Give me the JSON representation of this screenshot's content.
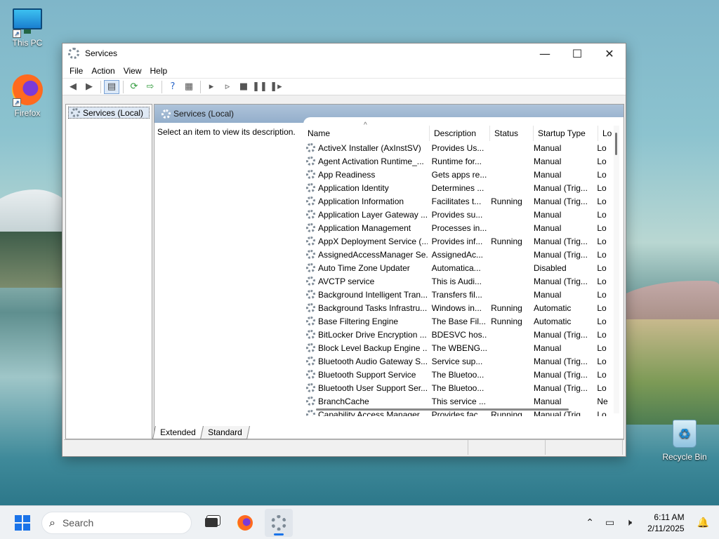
{
  "desktop": {
    "icons": [
      {
        "label": "This PC"
      },
      {
        "label": "Firefox"
      },
      {
        "label": "Recycle Bin"
      }
    ]
  },
  "window": {
    "title": "Services",
    "controls": {
      "minimize": "—",
      "maximize": "☐",
      "close": "✕"
    },
    "menu": [
      "File",
      "Action",
      "View",
      "Help"
    ],
    "tree": {
      "root_label": "Services (Local)"
    },
    "content_header": "Services (Local)",
    "description_prompt": "Select an item to view its description.",
    "columns": {
      "name": "Name",
      "description": "Description",
      "status": "Status",
      "startup": "Startup Type",
      "logon": "Lo"
    },
    "rows": [
      {
        "name": "ActiveX Installer (AxInstSV)",
        "desc": "Provides Us...",
        "status": "",
        "startup": "Manual",
        "logon": "Lo"
      },
      {
        "name": "Agent Activation Runtime_...",
        "desc": "Runtime for...",
        "status": "",
        "startup": "Manual",
        "logon": "Lo"
      },
      {
        "name": "App Readiness",
        "desc": "Gets apps re...",
        "status": "",
        "startup": "Manual",
        "logon": "Lo"
      },
      {
        "name": "Application Identity",
        "desc": "Determines ...",
        "status": "",
        "startup": "Manual (Trig...",
        "logon": "Lo"
      },
      {
        "name": "Application Information",
        "desc": "Facilitates t...",
        "status": "Running",
        "startup": "Manual (Trig...",
        "logon": "Lo"
      },
      {
        "name": "Application Layer Gateway ...",
        "desc": "Provides su...",
        "status": "",
        "startup": "Manual",
        "logon": "Lo"
      },
      {
        "name": "Application Management",
        "desc": "Processes in...",
        "status": "",
        "startup": "Manual",
        "logon": "Lo"
      },
      {
        "name": "AppX Deployment Service (...",
        "desc": "Provides inf...",
        "status": "Running",
        "startup": "Manual (Trig...",
        "logon": "Lo"
      },
      {
        "name": "AssignedAccessManager Se...",
        "desc": "AssignedAc...",
        "status": "",
        "startup": "Manual (Trig...",
        "logon": "Lo"
      },
      {
        "name": "Auto Time Zone Updater",
        "desc": "Automatica...",
        "status": "",
        "startup": "Disabled",
        "logon": "Lo"
      },
      {
        "name": "AVCTP service",
        "desc": "This is Audi...",
        "status": "",
        "startup": "Manual (Trig...",
        "logon": "Lo"
      },
      {
        "name": "Background Intelligent Tran...",
        "desc": "Transfers fil...",
        "status": "",
        "startup": "Manual",
        "logon": "Lo"
      },
      {
        "name": "Background Tasks Infrastru...",
        "desc": "Windows in...",
        "status": "Running",
        "startup": "Automatic",
        "logon": "Lo"
      },
      {
        "name": "Base Filtering Engine",
        "desc": "The Base Fil...",
        "status": "Running",
        "startup": "Automatic",
        "logon": "Lo"
      },
      {
        "name": "BitLocker Drive Encryption ...",
        "desc": "BDESVC hos...",
        "status": "",
        "startup": "Manual (Trig...",
        "logon": "Lo"
      },
      {
        "name": "Block Level Backup Engine ...",
        "desc": "The WBENG...",
        "status": "",
        "startup": "Manual",
        "logon": "Lo"
      },
      {
        "name": "Bluetooth Audio Gateway S...",
        "desc": "Service sup...",
        "status": "",
        "startup": "Manual (Trig...",
        "logon": "Lo"
      },
      {
        "name": "Bluetooth Support Service",
        "desc": "The Bluetoo...",
        "status": "",
        "startup": "Manual (Trig...",
        "logon": "Lo"
      },
      {
        "name": "Bluetooth User Support Ser...",
        "desc": "The Bluetoo...",
        "status": "",
        "startup": "Manual (Trig...",
        "logon": "Lo"
      },
      {
        "name": "BranchCache",
        "desc": "This service ...",
        "status": "",
        "startup": "Manual",
        "logon": "Ne"
      },
      {
        "name": "Capability Access Manager ...",
        "desc": "Provides fac...",
        "status": "Running",
        "startup": "Manual (Trig...",
        "logon": "Lo"
      }
    ],
    "tabs": [
      "Extended",
      "Standard"
    ]
  },
  "taskbar": {
    "search_placeholder": "Search",
    "clock_time": "6:11 AM",
    "clock_date": "2/11/2025"
  },
  "colors": {
    "accent": "#1a73e8",
    "header_band": "#93aecb"
  }
}
